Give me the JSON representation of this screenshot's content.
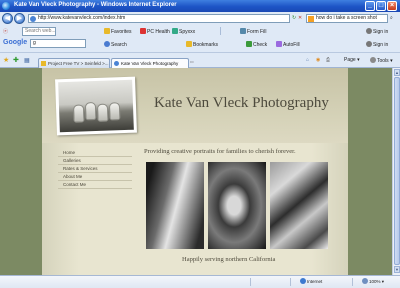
{
  "window": {
    "title": "Kate Van Vleck Photography - Windows Internet Explorer",
    "controls": {
      "minimize": "_",
      "maximize": "□",
      "close": "×"
    }
  },
  "address_bar": {
    "url": "http://www.katevanvleck.com/index.htm",
    "search_value": "how do i take a screen shot",
    "nav_back": "◀",
    "nav_forward": "▶"
  },
  "toolbar_top": {
    "items": [
      {
        "label": "Favorites",
        "icon": "star-icon",
        "color": "#e8b92a"
      },
      {
        "label": "PC Health",
        "icon": "pc-health-icon",
        "color": "#d33"
      },
      {
        "label": "Spyxxx",
        "icon": "spyware-icon",
        "color": "#3a8"
      },
      {
        "label": "Form Fill",
        "icon": "form-fill-icon",
        "color": "#58a"
      },
      {
        "label": "Sign in",
        "icon": "sign-in-icon",
        "color": "#777"
      }
    ],
    "search_placeholder": "Search web..."
  },
  "google_toolbar": {
    "logo": "Google",
    "input_prefix": "g",
    "items": [
      {
        "label": "Search",
        "icon": "search-icon",
        "color": "#4a7bd0"
      },
      {
        "label": "Bookmarks",
        "icon": "bookmark-icon",
        "color": "#e8b92a"
      },
      {
        "label": "Check",
        "icon": "spellcheck-icon",
        "color": "#3b9a3b"
      },
      {
        "label": "AutoFill",
        "icon": "autofill-icon",
        "color": "#9a6adf"
      },
      {
        "label": "Sign in",
        "icon": "sign-in-icon",
        "color": "#777"
      }
    ],
    "feed_label": "Feed"
  },
  "tabs": [
    {
      "label": "Project Free TV > Seinfeld >...",
      "active": false
    },
    {
      "label": "Kate Van Vleck Photography",
      "active": true
    }
  ],
  "command_bar": {
    "page_label": "Page",
    "tools_label": "Tools"
  },
  "site": {
    "title": "Kate Van Vleck Photography",
    "tagline": "Providing creative portraits for families to cherish forever.",
    "nav": [
      "Home",
      "Galleries",
      "Rates & Services",
      "About Me",
      "Contact Me"
    ],
    "footer_text": "Happily serving northern California"
  },
  "status_bar": {
    "zone": "Internet",
    "zoom": "100%"
  },
  "colors": {
    "titlebar": "#1d54c6",
    "page_background": "#e8e5d0",
    "page_outer": "#7c8a63",
    "text": "#4d4a3d"
  }
}
